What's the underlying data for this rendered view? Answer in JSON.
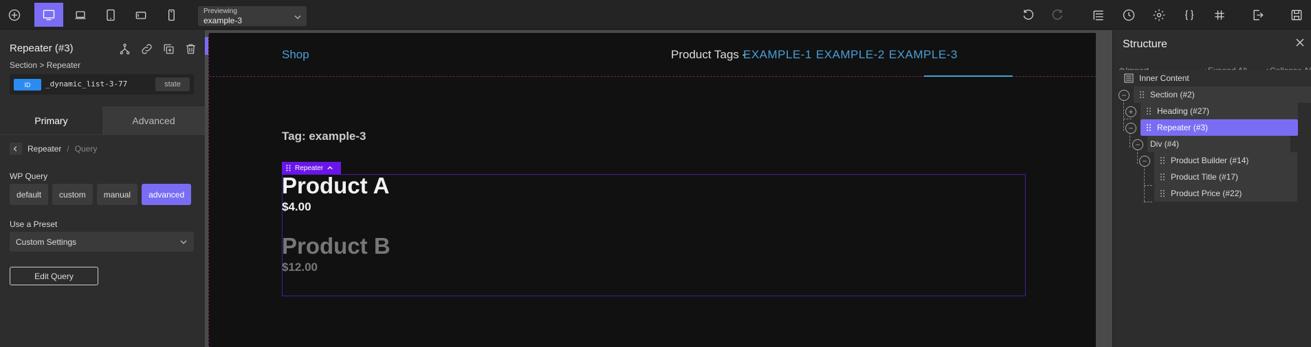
{
  "toolbar": {
    "preview_label": "Previewing",
    "preview_value": "example-3"
  },
  "element": {
    "title": "Repeater (#3)",
    "crumb": "Section > Repeater",
    "id_badge": "ID",
    "id_value": "_dynamic_list-3-77",
    "state_label": "state"
  },
  "panel": {
    "tabs": [
      "Primary",
      "Advanced"
    ],
    "breadcrumb_current": "Repeater",
    "breadcrumb_sep": "/",
    "breadcrumb_next": "Query",
    "wp_query_label": "WP Query",
    "wp_query_options": [
      "default",
      "custom",
      "manual",
      "advanced"
    ],
    "wp_query_selected": "advanced",
    "preset_label": "Use a Preset",
    "preset_value": "Custom Settings",
    "edit_query_label": "Edit Query"
  },
  "canvas": {
    "logo": "Shop",
    "tags_label": "Product Tags -",
    "tags": [
      "EXAMPLE-1",
      "EXAMPLE-2",
      "EXAMPLE-3"
    ],
    "active_tag": "EXAMPLE-3",
    "tag_heading": "Tag: example-3",
    "repeater_chip": "Repeater",
    "products": [
      {
        "name": "Product A",
        "price": "$4.00"
      },
      {
        "name": "Product B",
        "price": "$12.00"
      }
    ]
  },
  "structure": {
    "title": "Structure",
    "import_label": "Import",
    "expand_label": "Expand All",
    "collapse_label": "Collapse All",
    "nodes": [
      "Inner Content",
      "Section (#2)",
      "Heading (#27)",
      "Repeater (#3)",
      "Div (#4)",
      "Product Builder (#14)",
      "Product Title (#17)",
      "Product Price (#22)"
    ],
    "selected": "Repeater (#3)"
  },
  "colors": {
    "accent": "#7a6df3",
    "link": "#4a9fd8",
    "id_badge": "#2a8cf0",
    "repeater_chip": "#6a16e8"
  }
}
